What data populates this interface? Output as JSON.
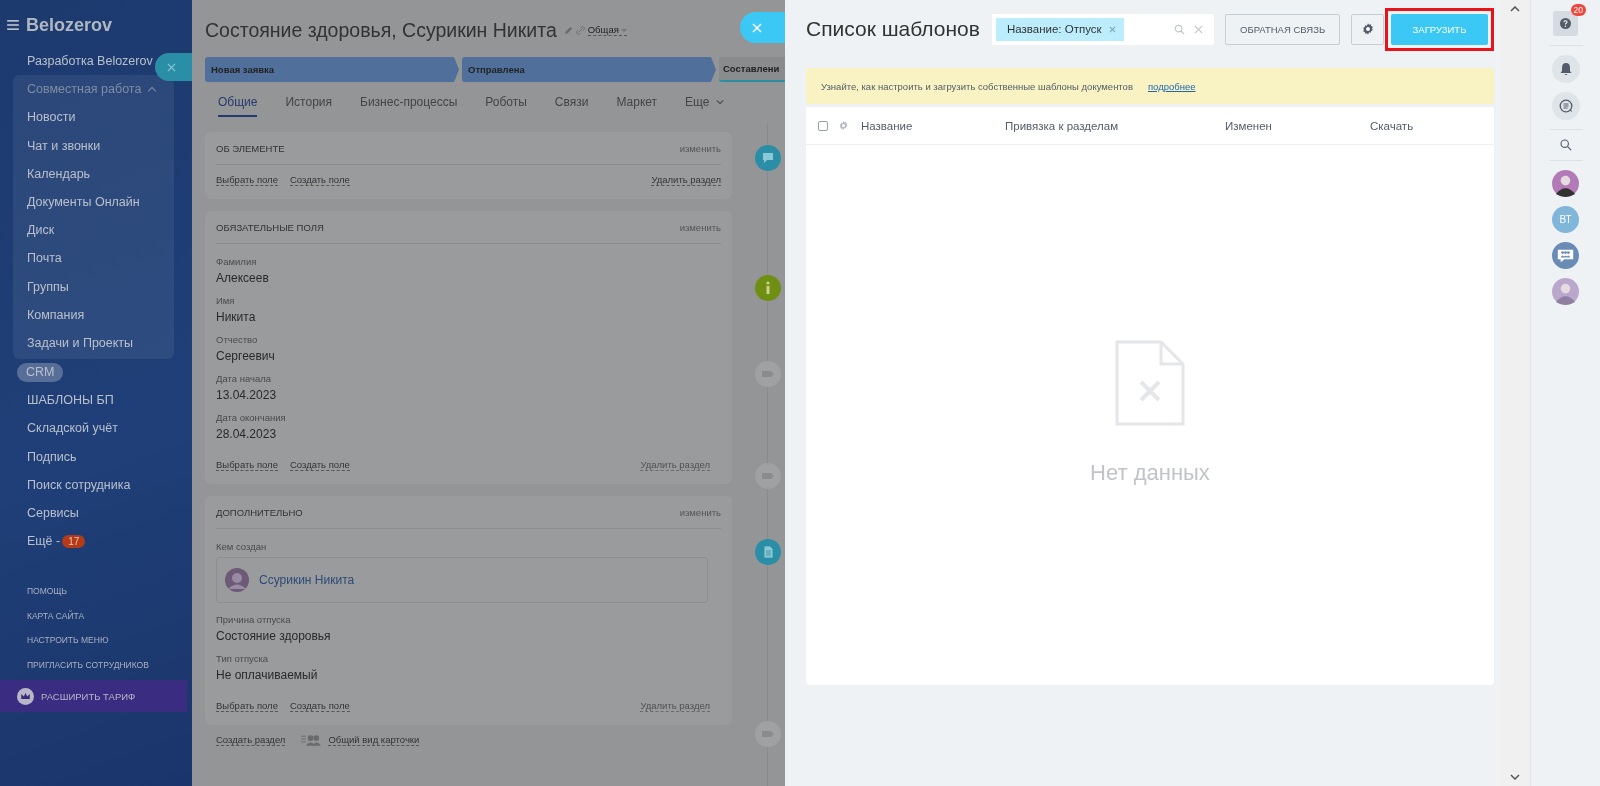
{
  "sidebar": {
    "logo": "Belozerov",
    "portal": "Разработка Belozerov",
    "group": {
      "label": "Совместная работа",
      "expanded": true,
      "items": [
        "Новости",
        "Чат и звонки",
        "Календарь",
        "Документы Онлайн",
        "Диск",
        "Почта",
        "Группы",
        "Компания",
        "Задачи и Проекты"
      ]
    },
    "items": [
      {
        "label": "CRM",
        "selected": true
      },
      {
        "label": "ШАБЛОНЫ БП",
        "selected": false
      },
      {
        "label": "Складской учёт",
        "selected": false
      },
      {
        "label": "Подпись",
        "selected": false
      },
      {
        "label": "Поиск сотрудника",
        "selected": false
      },
      {
        "label": "Сервисы",
        "selected": false
      },
      {
        "label": "Ещё -",
        "selected": false,
        "badge": "17"
      }
    ],
    "footer_links": [
      "ПОМОЩЬ",
      "КАРТА САЙТА",
      "НАСТРОИТЬ МЕНЮ",
      "ПРИГЛАСИТЬ СОТРУДНИКОВ"
    ],
    "upgrade": "РАСШИРИТЬ ТАРИФ"
  },
  "card": {
    "title": "Состояние здоровья, Ссурикин Никита",
    "category": "Общая",
    "stages": [
      {
        "label": "Новая заявка",
        "done": true
      },
      {
        "label": "Отправлена",
        "done": true
      },
      {
        "label": "Составлени",
        "done": false
      }
    ],
    "tabs": [
      {
        "label": "Общие",
        "selected": true
      },
      {
        "label": "История",
        "selected": false
      },
      {
        "label": "Бизнес-процессы",
        "selected": false
      },
      {
        "label": "Роботы",
        "selected": false
      },
      {
        "label": "Связи",
        "selected": false
      },
      {
        "label": "Маркет",
        "selected": false
      },
      {
        "label": "Еще",
        "selected": false
      }
    ],
    "sections": [
      {
        "title": "ОБ ЭЛЕМЕНТЕ",
        "edit": "изменить",
        "links": [
          "Выбрать поле",
          "Создать поле"
        ],
        "delete": {
          "label": "Удалить раздел",
          "disabled": false
        }
      },
      {
        "title": "ОБЯЗАТЕЛЬНЫЕ ПОЛЯ",
        "edit": "изменить",
        "fields": [
          {
            "kind": "text",
            "label": "Фамилия",
            "value": "Алексеев"
          },
          {
            "kind": "text",
            "label": "Имя",
            "value": "Никита"
          },
          {
            "kind": "text",
            "label": "Отчество",
            "value": "Сергеевич"
          },
          {
            "kind": "text",
            "label": "Дата начала",
            "value": "13.04.2023"
          },
          {
            "kind": "text",
            "label": "Дата окончания",
            "value": "28.04.2023"
          }
        ],
        "links": [
          "Выбрать поле",
          "Создать поле"
        ],
        "delete": {
          "label": "Удалить раздел",
          "disabled": true
        }
      },
      {
        "title": "ДОПОЛНИТЕЛЬНО",
        "edit": "изменить",
        "fields": [
          {
            "kind": "user",
            "label": "Кем создан",
            "value": "Ссурикин Никита"
          },
          {
            "kind": "text",
            "label": "Причина отпуска",
            "value": "Состояние здоровья"
          },
          {
            "kind": "text",
            "label": "Тип отпуска",
            "value": "Не оплачиваемый"
          }
        ],
        "links": [
          "Выбрать поле",
          "Создать поле"
        ],
        "delete": {
          "label": "Удалить раздел",
          "disabled": true
        }
      }
    ],
    "bottom_links": [
      "Создать раздел",
      "Общий вид карточки"
    ],
    "timeline": [
      {
        "kind": "chat"
      },
      {
        "kind": "info"
      },
      {
        "kind": "tag"
      },
      {
        "kind": "tag"
      },
      {
        "kind": "doc"
      },
      {
        "kind": "tag"
      }
    ]
  },
  "templates": {
    "title": "Список шаблонов",
    "filter_chip": "Название: Отпуск",
    "feedback_button": "ОБРАТНАЯ СВЯЗЬ",
    "upload_button": "ЗАГРУЗИТЬ",
    "upload_highlighted": true,
    "notice": "Узнайте, как настроить и загрузить собственные шаблоны документов",
    "notice_link": "подробнее",
    "select_all_checked": false,
    "columns": [
      "Название",
      "Привязка к разделам",
      "Изменен",
      "Скачать"
    ],
    "empty_text": "Нет данных"
  },
  "rail": {
    "help_badge": "20",
    "contacts": [
      {
        "kind": "photo"
      },
      {
        "kind": "initials",
        "text": "ВТ"
      },
      {
        "kind": "group"
      },
      {
        "kind": "photo"
      }
    ]
  }
}
